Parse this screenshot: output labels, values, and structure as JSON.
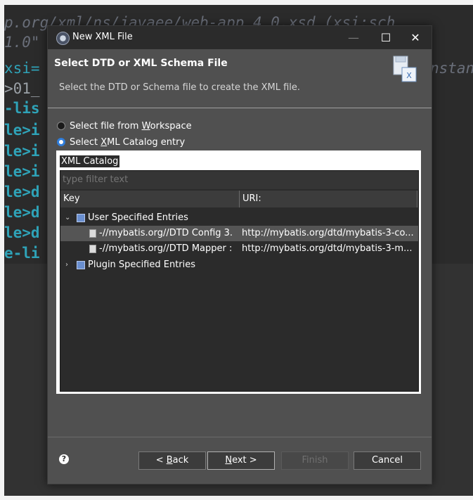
{
  "editor": {
    "lines": [
      {
        "text": "p.org/xml/ns/javaee/web-app_4_0.xsd (xsi:sch",
        "style": "italic"
      },
      {
        "text": "1.0\"",
        "style": "italic"
      },
      {
        "text": "xsi=",
        "style": "plain",
        "tail": "nstan"
      },
      {
        "text": ">01_",
        "style": "plain"
      },
      {
        "text": "-lis",
        "style": "tag"
      },
      {
        "text": "le>i",
        "style": "tag"
      },
      {
        "text": "le>i",
        "style": "tag"
      },
      {
        "text": "le>i",
        "style": "tag"
      },
      {
        "text": "le>d",
        "style": "tag"
      },
      {
        "text": "le>d",
        "style": "tag"
      },
      {
        "text": "le>d",
        "style": "tag"
      },
      {
        "text": "e-li",
        "style": "tag"
      }
    ]
  },
  "dialog": {
    "title": "New XML File",
    "window_controls": {
      "minimize": "—",
      "maximize": "☐",
      "close": "✕"
    },
    "heading": "Select DTD or XML Schema File",
    "subtitle": "Select the DTD or Schema file to create the XML file.",
    "options": [
      {
        "pre": "Select file from ",
        "accel": "W",
        "post": "orkspace",
        "checked": false
      },
      {
        "pre": "Select ",
        "accel": "X",
        "post": "ML Catalog entry",
        "checked": true
      }
    ],
    "catalog_title": "XML Catalog",
    "filter_placeholder": "type filter text",
    "columns": [
      "Key",
      "URI:"
    ],
    "tree": {
      "user_group": "User Specified Entries",
      "entries": [
        {
          "key": "-//mybatis.org//DTD Config 3.",
          "uri": "http://mybatis.org/dtd/mybatis-3-co...",
          "selected": true
        },
        {
          "key": "-//mybatis.org//DTD Mapper :",
          "uri": "http://mybatis.org/dtd/mybatis-3-m...",
          "selected": false
        }
      ],
      "plugin_group": "Plugin Specified Entries"
    },
    "buttons": {
      "help": "?",
      "back": {
        "pre": "< ",
        "accel": "B",
        "post": "ack"
      },
      "next": {
        "pre": "",
        "accel": "N",
        "post": "ext >"
      },
      "finish": "Finish",
      "cancel": "Cancel"
    }
  }
}
